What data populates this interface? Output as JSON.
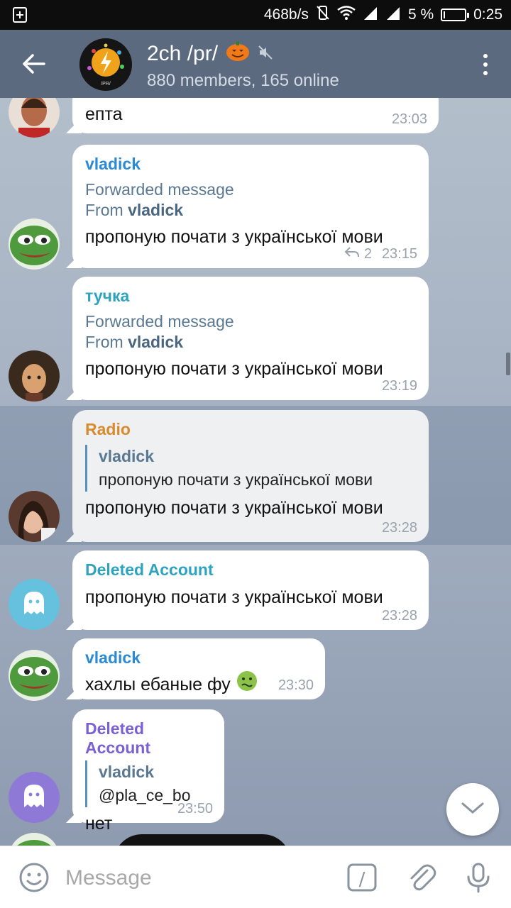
{
  "status_bar": {
    "speed": "468b/s",
    "battery": "5 %",
    "time": "0:25"
  },
  "header": {
    "title": "2ch /pr/",
    "subtitle": "880 members, 165 online",
    "avatar_text": "/PR/"
  },
  "messages": [
    {
      "text": "епта",
      "time": "23:03"
    },
    {
      "author": "vladick",
      "author_color": "#2b8ad6",
      "forwarded_label": "Forwarded message",
      "from_label": "From",
      "from_name": "vladick",
      "text": "пропоную почати з української мови",
      "replies": "2",
      "time": "23:15"
    },
    {
      "author": "тучка",
      "author_color": "#2ea3c0",
      "forwarded_label": "Forwarded message",
      "from_label": "From",
      "from_name": "vladick",
      "text": "пропоную почати з української мови",
      "time": "23:19"
    },
    {
      "author": "Radio",
      "author_color": "#d98b2b",
      "reply_name": "vladick",
      "reply_text": "пропоную почати з української мови",
      "text": "пропоную почати з української мови",
      "time": "23:28"
    },
    {
      "author": "Deleted Account",
      "author_color": "#2ea3c0",
      "text": "пропоную почати з української мови",
      "time": "23:28"
    },
    {
      "author": "vladick",
      "author_color": "#2b8ad6",
      "text": "хахлы ебаные фу",
      "time": "23:30"
    },
    {
      "author": "Deleted Account",
      "author_color": "#7b5fd4",
      "reply_name": "vladick",
      "reply_text": "@pla_ce_bo",
      "text": "нет",
      "time": "23:50"
    }
  ],
  "input": {
    "placeholder": "Message",
    "command_symbol": "/"
  },
  "colors": {
    "header": "#5b6a7e",
    "link": "#5a8fc0"
  }
}
